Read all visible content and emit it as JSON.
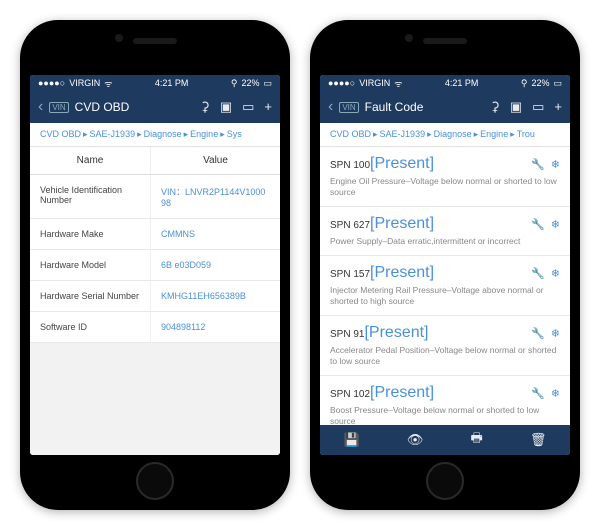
{
  "status": {
    "carrier": "VIRGIN",
    "time": "4:21 PM",
    "battery": "22%"
  },
  "left": {
    "title": "CVD OBD",
    "breadcrumb": [
      "CVD OBD",
      "SAE-J1939",
      "Diagnose",
      "Engine",
      "Sys"
    ],
    "columns": {
      "name": "Name",
      "value": "Value"
    },
    "rows": [
      {
        "name": "Vehicle Identification Number",
        "value": "VIN：LNVR2P1144V100098"
      },
      {
        "name": "Hardware Make",
        "value": "CMMNS"
      },
      {
        "name": "Hardware Model",
        "value": "6B e03D059"
      },
      {
        "name": "Hardware Serial Number",
        "value": "KMHG11EH656389B"
      },
      {
        "name": "Software ID",
        "value": "904898112"
      }
    ]
  },
  "right": {
    "title": "Fault Code",
    "breadcrumb": [
      "CVD OBD",
      "SAE-J1939",
      "Diagnose",
      "Engine",
      "Trou"
    ],
    "faults": [
      {
        "code": "SPN 100",
        "status": "[Present]",
        "desc": "Engine Oil Pressure–Voltage below normal or shorted to low source"
      },
      {
        "code": "SPN 627",
        "status": "[Present]",
        "desc": "Power Supply–Data erratic,intermittent or incorrect"
      },
      {
        "code": "SPN 157",
        "status": "[Present]",
        "desc": "Injector Metering Rail Pressure–Voltage above normal or shorted  to high source"
      },
      {
        "code": "SPN 91",
        "status": "[Present]",
        "desc": "Accelerator Pedal Position–Voltage below normal or shorted to low source"
      },
      {
        "code": "SPN 102",
        "status": "[Present]",
        "desc": "Boost Pressure–Voltage below normal or shorted to low source"
      }
    ]
  }
}
